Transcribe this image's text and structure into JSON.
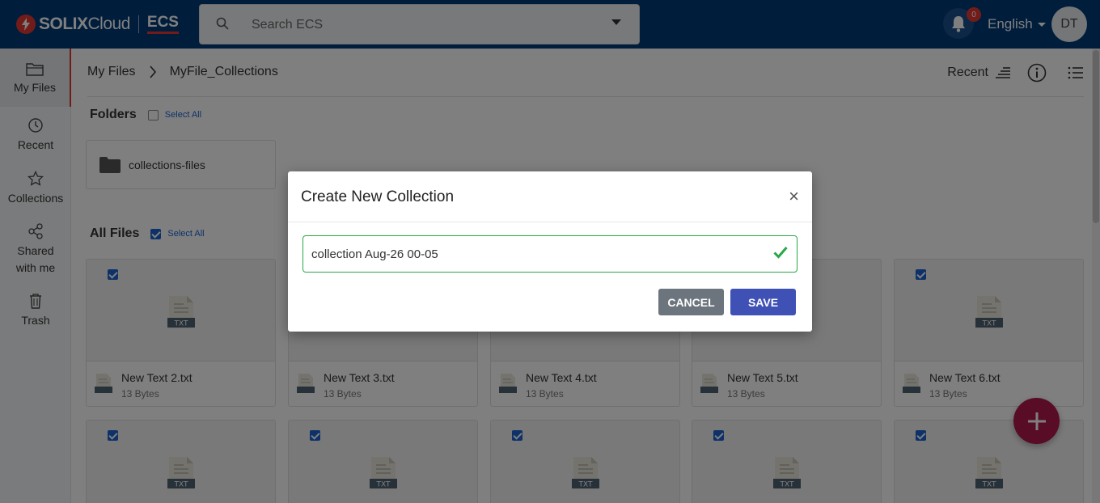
{
  "header": {
    "brand_solix": "SOLIX",
    "brand_cloud": "Cloud",
    "brand_product": "ECS",
    "search_placeholder": "Search ECS",
    "notification_count": "0",
    "language": "English",
    "avatar_initials": "DT"
  },
  "sidebar": {
    "items": [
      {
        "label": "My Files",
        "icon": "folder-icon",
        "active": true
      },
      {
        "label": "Recent",
        "icon": "history-icon"
      },
      {
        "label": "Collections",
        "icon": "star-icon"
      },
      {
        "label": "Shared with me",
        "icon": "share-icon"
      },
      {
        "label": "Trash",
        "icon": "trash-icon"
      }
    ]
  },
  "breadcrumb": {
    "root": "My Files",
    "current": "MyFile_Collections"
  },
  "toolbar": {
    "sort_label": "Recent"
  },
  "folders": {
    "title": "Folders",
    "select_all": "Select All",
    "items": [
      {
        "name": "collections-files"
      }
    ]
  },
  "files": {
    "title": "All Files",
    "select_all": "Select All",
    "items": [
      {
        "name": "New Text 2.txt",
        "size": "13 Bytes",
        "type": "TXT"
      },
      {
        "name": "New Text 3.txt",
        "size": "13 Bytes",
        "type": "TXT"
      },
      {
        "name": "New Text 4.txt",
        "size": "13 Bytes",
        "type": "TXT"
      },
      {
        "name": "New Text 5.txt",
        "size": "13 Bytes",
        "type": "TXT"
      },
      {
        "name": "New Text 6.txt",
        "size": "13 Bytes",
        "type": "TXT"
      }
    ],
    "second_row_type": "TXT"
  },
  "modal": {
    "title": "Create New Collection",
    "close": "×",
    "input_value": "collection Aug-26 00-05",
    "cancel_label": "CANCEL",
    "save_label": "SAVE"
  },
  "colors": {
    "header_bg": "#003a79",
    "accent": "#e53935",
    "save_button": "#3f51b5",
    "cancel_button": "#6c757d",
    "valid": "#28a745",
    "fab": "#b0184d"
  }
}
